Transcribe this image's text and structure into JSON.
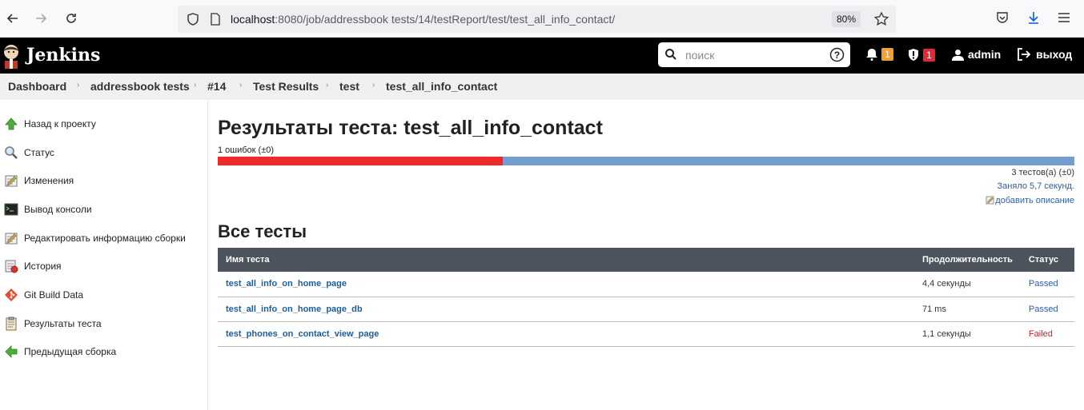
{
  "browser": {
    "url_host": "localhost",
    "url_rest": ":8080/job/addressbook tests/14/testReport/test/test_all_info_contact/",
    "zoom": "80%"
  },
  "header": {
    "brand": "Jenkins",
    "search_placeholder": "поиск",
    "notifications_count": "1",
    "security_count": "1",
    "user": "admin",
    "logout": "выход"
  },
  "breadcrumb": [
    "Dashboard",
    "addressbook tests",
    "#14",
    "Test Results",
    "test",
    "test_all_info_contact"
  ],
  "sidebar": {
    "items": [
      {
        "label": "Назад к проекту",
        "icon": "up-arrow-icon"
      },
      {
        "label": "Статус",
        "icon": "magnifier-icon"
      },
      {
        "label": "Изменения",
        "icon": "notepad-icon"
      },
      {
        "label": "Вывод консоли",
        "icon": "terminal-icon"
      },
      {
        "label": "Редактировать информацию сборки",
        "icon": "notepad-icon"
      },
      {
        "label": "История",
        "icon": "history-icon"
      },
      {
        "label": "Git Build Data",
        "icon": "git-icon"
      },
      {
        "label": "Результаты теста",
        "icon": "clipboard-icon"
      },
      {
        "label": "Предыдущая сборка",
        "icon": "left-arrow-icon"
      }
    ]
  },
  "main": {
    "title": "Результаты теста: test_all_info_contact",
    "failures": "1 ошибок (±0)",
    "fail_fraction": 0.333,
    "tests_count": "3 тестов(а) (±0)",
    "duration": "Заняло 5,7 секунд.",
    "add_description": "добавить описание",
    "all_tests_heading": "Все тесты",
    "table": {
      "headers": [
        "Имя теста",
        "Продолжительность",
        "Статус"
      ],
      "rows": [
        {
          "name": "test_all_info_on_home_page",
          "duration": "4,4 секунды",
          "status": "Passed"
        },
        {
          "name": "test_all_info_on_home_page_db",
          "duration": "71 ms",
          "status": "Passed"
        },
        {
          "name": "test_phones_on_contact_view_page",
          "duration": "1,1 секунды",
          "status": "Failed"
        }
      ]
    }
  },
  "colors": {
    "fail": "#ef2929",
    "pass": "#729fcf",
    "header_bg": "#000000",
    "table_header_bg": "#4d545d"
  }
}
